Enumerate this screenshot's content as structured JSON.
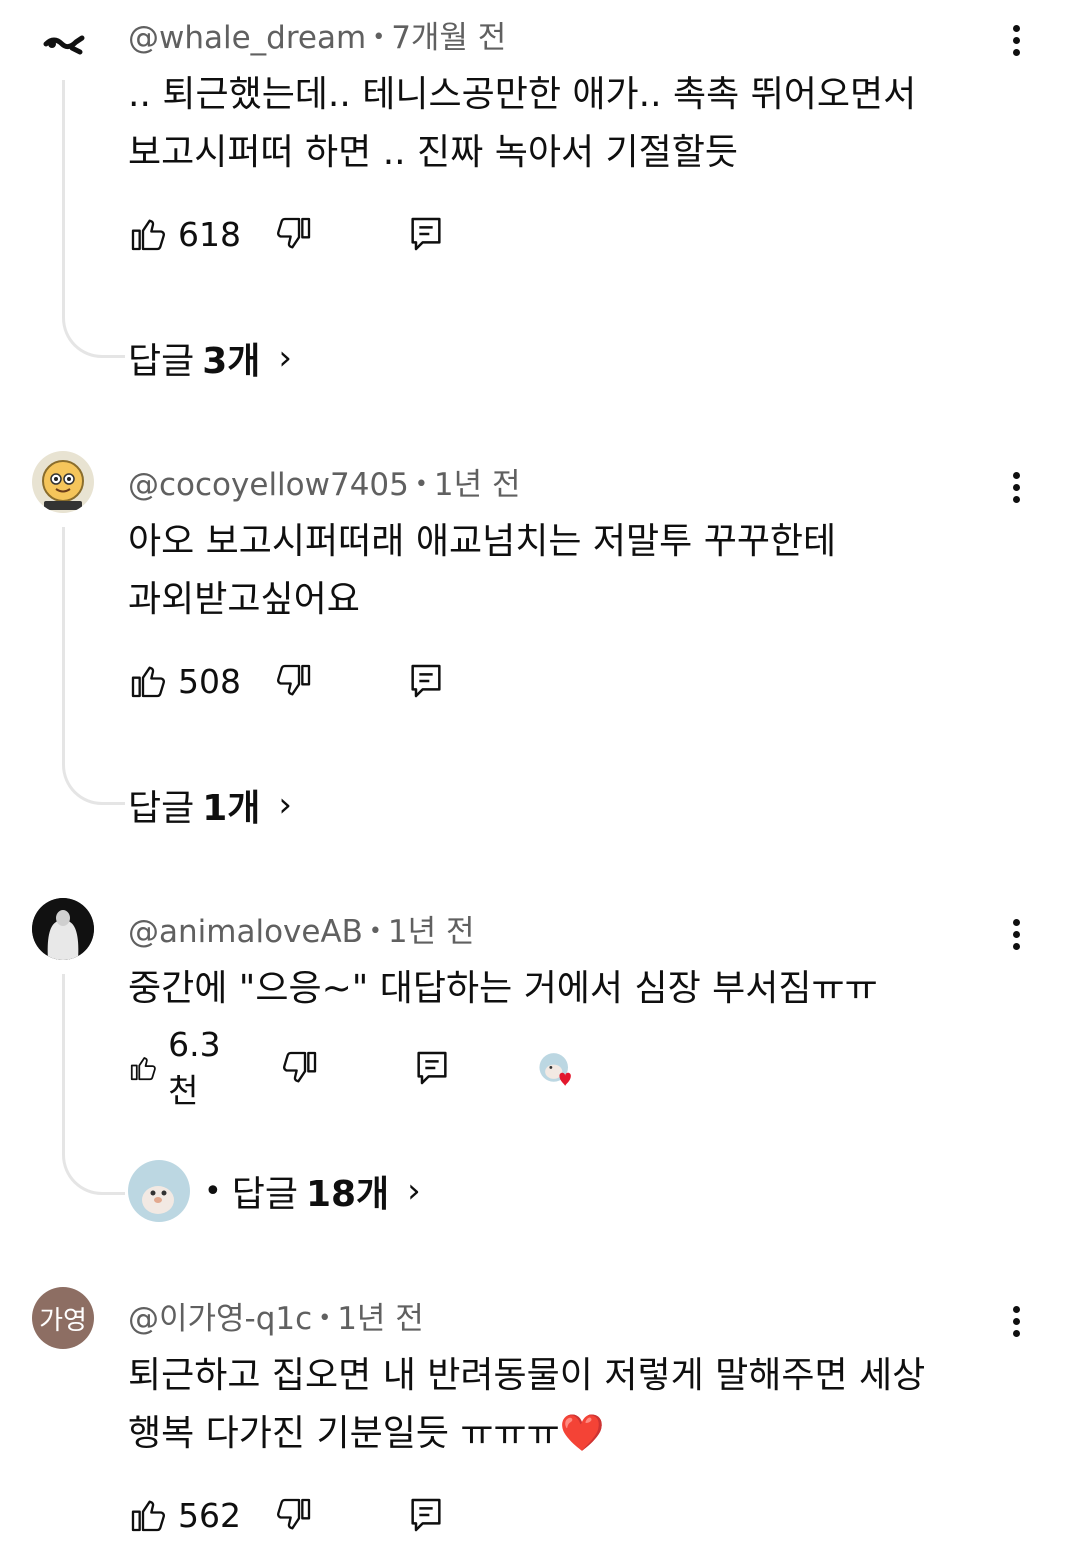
{
  "comments": [
    {
      "author": "@whale_dream",
      "time": "7개월 전",
      "text_line1": "..  퇴근했는데.. 테니스공만한 애가..  촉촉  뛰어오면서",
      "text_line2": "보고시퍼떠 하면 .. 진짜 녹아서 기절할듯",
      "likes": "618",
      "replies_label": "답글",
      "replies_count": "3개",
      "avatar_icon": "whale-logo-icon"
    },
    {
      "author": "@cocoyellow7405",
      "time": "1년 전",
      "text_line1": "아오 보고시퍼떠래 애교넘치는 저말투 꾸꾸한테",
      "text_line2": "과외받고싶어요",
      "likes": "508",
      "replies_label": "답글",
      "replies_count": "1개",
      "avatar_icon": "cartoon-face-icon"
    },
    {
      "author": "@animaloveAB",
      "time": "1년 전",
      "text_line1": "중간에 \"으응~\" 대답하는 거에서 심장 부서짐ㅠㅠ",
      "likes": "6.3천",
      "replies_label": "답글",
      "replies_count": "18개",
      "avatar_icon": "person-photo-icon",
      "creator_heart": true
    },
    {
      "author": "@이가영-q1c",
      "time": "1년 전",
      "text_line1": "퇴근하고 집오면 내 반려동물이 저렇게 말해주면 세상",
      "text_line2": "행복 다가진 기분일듯 ㅠㅠㅠ❤️",
      "likes": "562",
      "avatar_initials": "가영",
      "avatar_color": "#8d6e63"
    }
  ],
  "colors": {
    "meta": "#606060",
    "thread_line": "#e5e5e5",
    "heart": "#e3182d"
  }
}
